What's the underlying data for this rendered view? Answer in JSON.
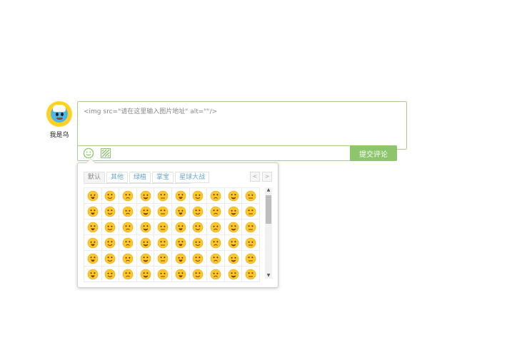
{
  "user": {
    "name": "我是乌",
    "avatar_icon": "smiling-bird-avatar"
  },
  "comment": {
    "value": "<img src=\"请在这里输入图片地址\" alt=\"\"/>",
    "border_color": "#a7d08a"
  },
  "toolbar": {
    "emoji_icon": "smile-icon",
    "image_icon": "image-icon",
    "submit_label": "提交评论",
    "accent": "#8cc56c"
  },
  "emoji_panel": {
    "tabs": [
      {
        "label": "默认",
        "active": true
      },
      {
        "label": "其他",
        "active": false
      },
      {
        "label": "绿植",
        "active": false
      },
      {
        "label": "掌宝",
        "active": false
      },
      {
        "label": "星球大战",
        "active": false
      }
    ],
    "prev_label": "<",
    "next_label": ">",
    "scroll_up": "▲",
    "scroll_down": "▼",
    "emoji_icon": "yellow-emoji-face-icon",
    "emoji_count": 60,
    "emoji_color": "#ffc72a"
  }
}
